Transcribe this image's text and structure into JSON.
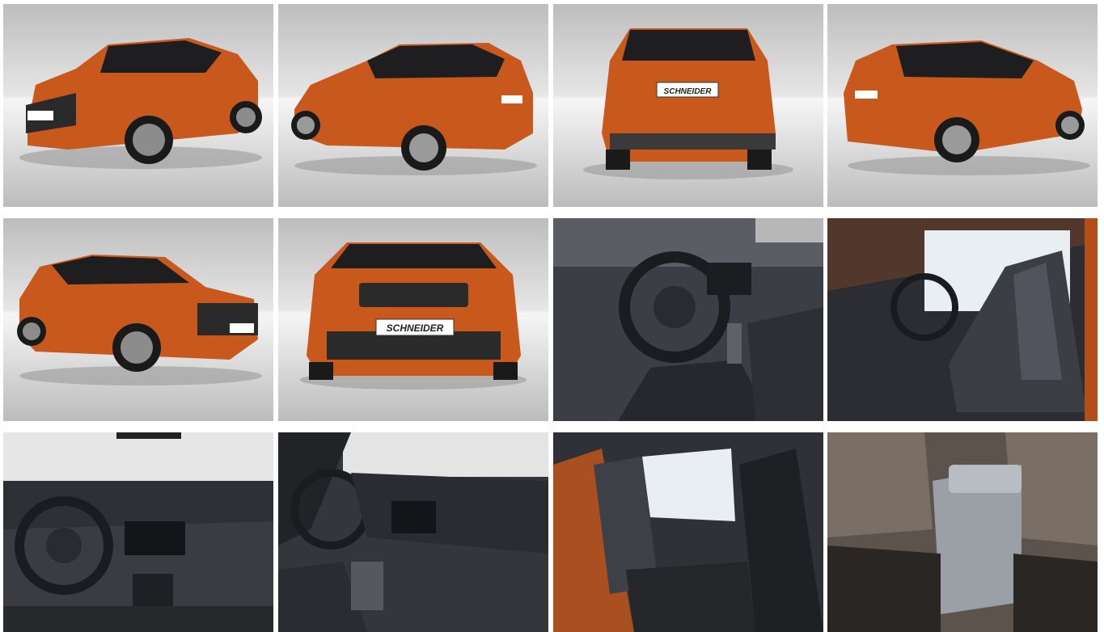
{
  "gallery": {
    "colors": {
      "body_orange": "#c8581c",
      "body_orange_dark": "#8f3a10",
      "roof_black": "#1e1e20",
      "studio_top": "#cfcfcf",
      "studio_floor": "#f4f4f4",
      "interior_dark": "#2a2c31",
      "interior_mid": "#4a4d54",
      "window_light": "#e8eef2"
    },
    "plates": {
      "rear": "SCHNEIDER",
      "front": "SCHNEIDER"
    },
    "photos": [
      {
        "label": "",
        "view": "front-left-exterior"
      },
      {
        "label": "",
        "view": "rear-left-exterior"
      },
      {
        "label": "",
        "view": "rear-exterior"
      },
      {
        "label": "",
        "view": "rear-right-exterior"
      },
      {
        "label": "",
        "view": "front-right-exterior"
      },
      {
        "label": "",
        "view": "front-exterior"
      },
      {
        "label": "",
        "view": "steering-interior"
      },
      {
        "label": "",
        "view": "front-seats-interior"
      },
      {
        "label": "",
        "view": "dashboard-interior"
      },
      {
        "label": "",
        "view": "dashboard-side-interior"
      },
      {
        "label": "",
        "view": "rear-seats-interior"
      },
      {
        "label": "",
        "view": "armrest-interior"
      }
    ]
  }
}
